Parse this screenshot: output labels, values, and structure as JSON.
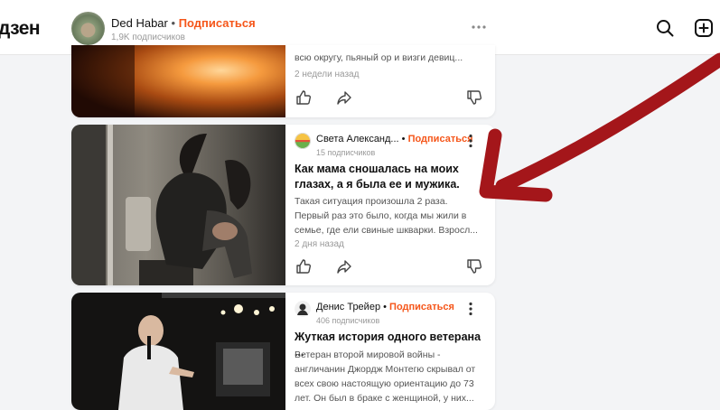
{
  "header": {
    "logo": "дзен",
    "channel_name": "Ded Habar",
    "separator": "•",
    "subscribe": "Подписаться",
    "subscribers": "1,9K подписчиков"
  },
  "cards": [
    {
      "desc": "всю округу, пьяный ор и визги девиц...",
      "date": "2 недели назад"
    },
    {
      "author": "Света Александ...",
      "separator": "•",
      "subscribe": "Подписаться",
      "subscribers": "15 подписчиков",
      "title_1": "Как мама сношалась на моих",
      "title_2": "глазах, а я была ее и мужика.",
      "desc_1": "Такая ситуация произошла 2 раза.",
      "desc_2": "Первый раз это было, когда мы жили в",
      "desc_3": "семье, где ели свиные шкварки. Взросл...",
      "date": "2 дня назад"
    },
    {
      "author": "Денис Трейер",
      "separator": "•",
      "subscribe": "Подписаться",
      "subscribers": "406 подписчиков",
      "title": "Жуткая история одного ветерана ...",
      "desc_1": "Ветеран второй мировой войны -",
      "desc_2": "англичанин Джордж Монтегю скрывал от",
      "desc_3": "всех свою настоящую ориентацию до 73",
      "desc_4": "лет. Он был в браке с женщиной, у них..."
    }
  ],
  "icons": {
    "search": "search-icon",
    "add": "add-post-icon",
    "like": "thumb-up-icon",
    "share": "share-icon",
    "dislike": "thumb-down-icon",
    "more": "more-icon"
  },
  "colors": {
    "subscribe": "#f5561a",
    "arrow": "#a4161a",
    "background": "#f3f4f6"
  }
}
